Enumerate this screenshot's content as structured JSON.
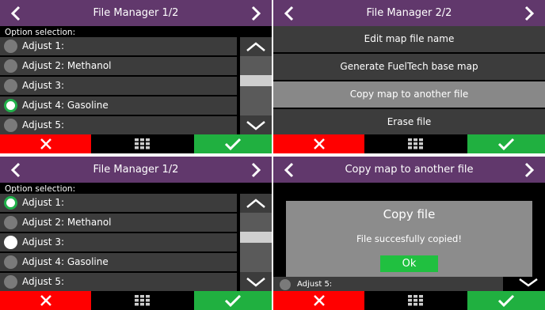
{
  "panel1": {
    "title": "File Manager 1/2",
    "subtitle": "Option selection:",
    "options": [
      "Adjust 1:",
      "Adjust 2: Methanol",
      "Adjust 3:",
      "Adjust 4: Gasoline",
      "Adjust 5:"
    ]
  },
  "panel2": {
    "title": "File Manager 2/2",
    "menu": [
      "Edit map file name",
      "Generate FuelTech base map",
      "Copy map to another file",
      "Erase file"
    ]
  },
  "panel3": {
    "title": "File Manager 1/2",
    "subtitle": "Option selection:",
    "options": [
      "Adjust 1:",
      "Adjust 2: Methanol",
      "Adjust 3:",
      "Adjust 4: Gasoline",
      "Adjust 5:"
    ]
  },
  "panel4": {
    "title": "Copy map to another file",
    "dialog_title": "Copy file",
    "dialog_message": "File succesfully copied!",
    "ok_label": "Ok",
    "background_option": "Adjust 5:"
  },
  "colors": {
    "header": "#61386c",
    "row": "#3c3c3c",
    "selected_menu": "#888888",
    "cancel": "#ff0000",
    "confirm": "#20b040",
    "radio_check": "#20b04a"
  },
  "icons": {
    "prev": "chevron-left-icon",
    "next": "chevron-right-icon",
    "scroll_up": "chevron-up-icon",
    "scroll_down": "chevron-down-icon",
    "cancel": "x-icon",
    "home": "grid-icon",
    "confirm": "check-icon"
  }
}
